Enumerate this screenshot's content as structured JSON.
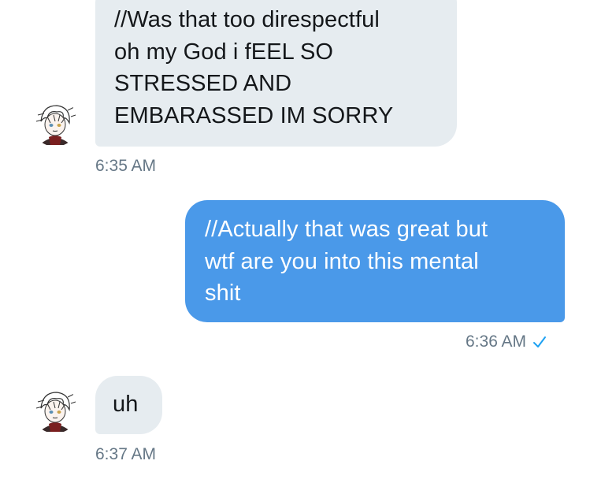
{
  "conversation": {
    "messages": [
      {
        "direction": "incoming",
        "text": "//Was that too direspectful\noh my God i fEEL SO\nSTRESSED AND\nEMBARASSED IM SORRY",
        "time": "6:35 AM",
        "avatar_icon": "anime-character-avatar-icon"
      },
      {
        "direction": "outgoing",
        "text": "//Actually that was great but\nwtf are you into this mental\nshit",
        "time": "6:36 AM",
        "status_icon": "checkmark-icon"
      },
      {
        "direction": "incoming",
        "text": "uh",
        "time": "6:37 AM",
        "avatar_icon": "anime-character-avatar-icon"
      }
    ]
  },
  "colors": {
    "incoming_bubble": "#e6ecf0",
    "outgoing_bubble": "#4a99e9",
    "timestamp": "#657786",
    "checkmark": "#1da1f2"
  }
}
